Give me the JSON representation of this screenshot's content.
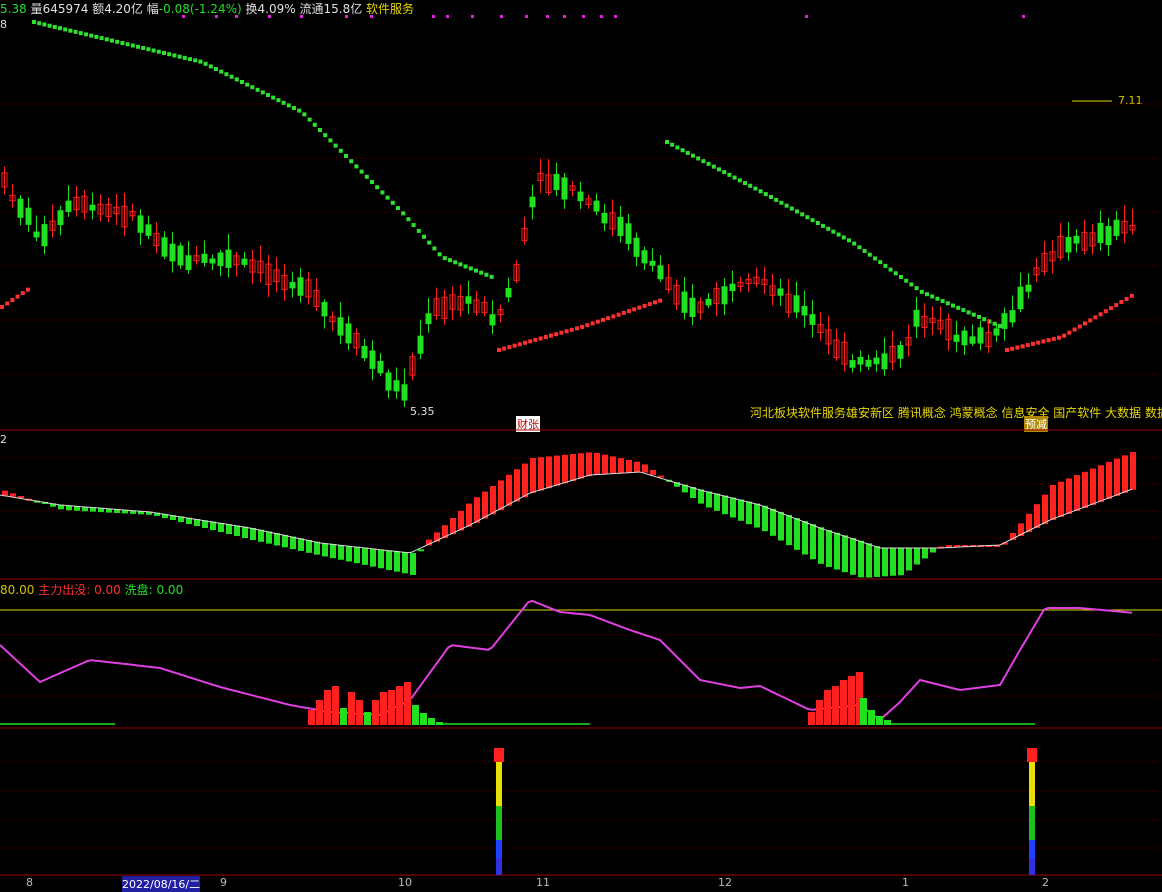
{
  "header": {
    "price": "5.38",
    "volume_label": "量",
    "volume": "645974",
    "amount_label": "额",
    "amount": "4.20亿",
    "change_label": "幅",
    "change": "-0.08(-1.24%)",
    "turnover_label": "换",
    "turnover": "4.09%",
    "float_label": "流通",
    "float": "15.8亿",
    "sector": "软件服务"
  },
  "panel1": {
    "axis_stub": "8",
    "high_label": "7.11",
    "low_label": "5.35",
    "concepts": "河北板块软件服务雄安新区 腾讯概念 鸿蒙概念 信息安全 国产软件 大数据 数据",
    "tag_left": "财张",
    "tag_right": "预减"
  },
  "panel2": {
    "axis_stub": "2"
  },
  "panel3": {
    "level": "80.00",
    "main_label": "主力出没:",
    "main_value": "0.00",
    "wash_label": "洗盘:",
    "wash_value": "0.00"
  },
  "xaxis": {
    "labels": [
      "8",
      "2022/08/16/二",
      "9",
      "10",
      "11",
      "12",
      "1",
      "2"
    ]
  },
  "colors": {
    "up": "#ff2020",
    "down": "#20e020",
    "line": "#e040e0",
    "stop_up": "#ff3030",
    "stop_down": "#30e030",
    "separator": "#a00000",
    "level_line": "#d8d800"
  },
  "chart_data": [
    {
      "type": "candlestick",
      "title": "",
      "annotations": [
        "7.11",
        "5.35"
      ]
    },
    {
      "type": "bar",
      "title": ""
    },
    {
      "type": "line",
      "title": "",
      "series": [
        {
          "name": "主力出没",
          "values": [
            0
          ]
        },
        {
          "name": "洗盘",
          "values": [
            0
          ]
        }
      ],
      "reference_line": 80
    },
    {
      "type": "bar",
      "title": ""
    }
  ]
}
